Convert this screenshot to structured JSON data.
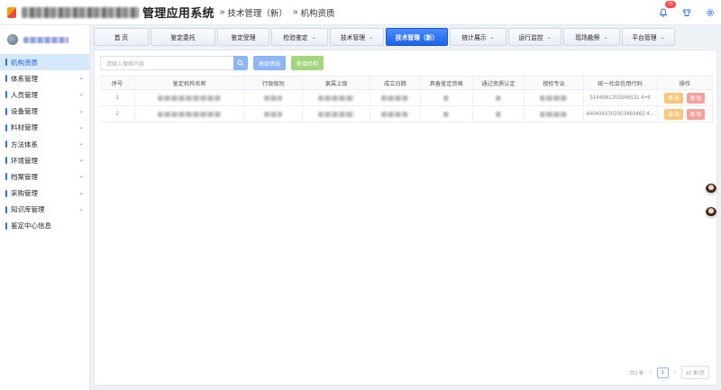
{
  "header": {
    "app_title": "管理应用系统",
    "breadcrumb": [
      "技术管理（新）",
      "机构资质"
    ],
    "notification_count": "71"
  },
  "sidebar": {
    "items": [
      {
        "label": "机构资质",
        "active": true,
        "has_children": false
      },
      {
        "label": "体系管理",
        "has_children": true
      },
      {
        "label": "人员管理",
        "has_children": true
      },
      {
        "label": "设备管理",
        "has_children": true
      },
      {
        "label": "料材管理",
        "has_children": true
      },
      {
        "label": "方法体系",
        "has_children": true
      },
      {
        "label": "环境管理",
        "has_children": true
      },
      {
        "label": "档案管理",
        "has_children": true
      },
      {
        "label": "采购管理",
        "has_children": true
      },
      {
        "label": "知识库管理",
        "has_children": true
      },
      {
        "label": "鉴定中心信息",
        "has_children": false
      }
    ]
  },
  "nav": {
    "tabs": [
      {
        "label": "首 页",
        "dropdown": false
      },
      {
        "label": "鉴定委托",
        "dropdown": false
      },
      {
        "label": "鉴定受理",
        "dropdown": false
      },
      {
        "label": "检验鉴定",
        "dropdown": true
      },
      {
        "label": "技术管理",
        "dropdown": true
      },
      {
        "label": "技术管理（新）",
        "dropdown": false,
        "active": true
      },
      {
        "label": "统计展示",
        "dropdown": true
      },
      {
        "label": "运行监控",
        "dropdown": true
      },
      {
        "label": "现场勘察",
        "dropdown": true
      },
      {
        "label": "平台管理",
        "dropdown": true
      }
    ]
  },
  "toolbar": {
    "search_placeholder": "请输入搜索内容",
    "advanced_filter": "高级筛选",
    "add_org": "新增机构"
  },
  "table": {
    "columns": [
      "序号",
      "鉴定机构名称",
      "行政级别",
      "隶属上级",
      "成立日期",
      "具备鉴定资格",
      "通过资质认定",
      "授权专业",
      "统一社会信用代码",
      "操作"
    ],
    "rows": [
      {
        "index": "1",
        "credit_code": "5144961203546531 4+6",
        "edit": "编 辑",
        "delete": "删 除"
      },
      {
        "index": "2",
        "credit_code": "4404041002003463463 4...",
        "edit": "编 辑",
        "delete": "删 除"
      }
    ]
  },
  "pager": {
    "total": "共2 条",
    "current_page": "1",
    "page_size": "10 条/页"
  },
  "colors": {
    "primary": "#2f6fe0",
    "active_tab": "#1f63e6",
    "sidebar_active_bg": "#d6e8fb",
    "edit": "#f7c77b",
    "delete": "#f7a0a0"
  }
}
